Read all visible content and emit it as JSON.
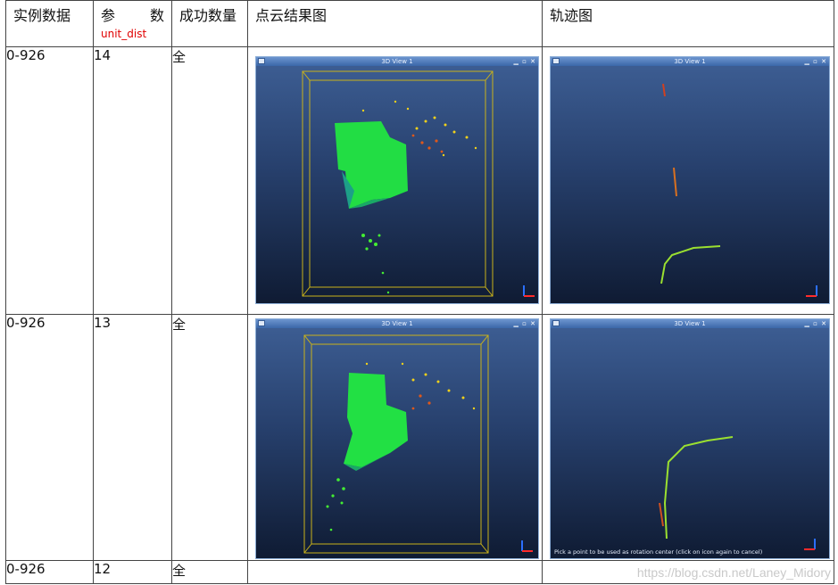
{
  "table": {
    "headers": {
      "instance": "实例数据",
      "param_part1": "参",
      "param_part2": "数",
      "param_unit": "unit_dist",
      "success": "成功数量",
      "pointcloud": "点云结果图",
      "trajectory": "轨迹图"
    },
    "rows": [
      {
        "instance": "0-926",
        "param": "14",
        "success": "全"
      },
      {
        "instance": "0-926",
        "param": "13",
        "success": "全"
      },
      {
        "instance": "0-926",
        "param": "12",
        "success": "全"
      }
    ]
  },
  "viewer": {
    "window_title": "3D View 1",
    "window_buttons": "▁ ▫ ✕",
    "status_text": "Pick a point to be used as rotation center (click on icon again to cancel)"
  },
  "watermark": "https://blog.csdn.net/Laney_Midory",
  "colors": {
    "accent_red": "#e00000",
    "viewer_bg_top": "#3e5f95",
    "viewer_bg_bottom": "#0f1b33",
    "bbox_yellow": "#c9b21a",
    "cloud_green": "#22ee22"
  }
}
